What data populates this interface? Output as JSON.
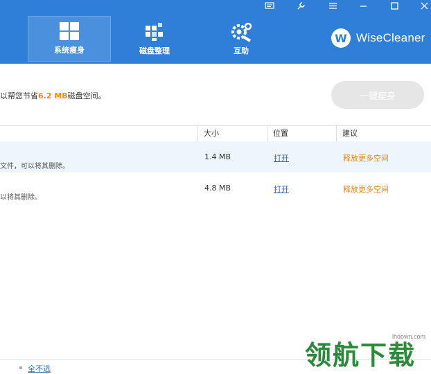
{
  "header": {
    "tabs": [
      {
        "label": "系统瘦身",
        "icon": "windows-icon"
      },
      {
        "label": "磁盘整理",
        "icon": "defrag-icon"
      },
      {
        "label": "互助",
        "icon": "gears-icon"
      }
    ],
    "brand": {
      "logo_letter": "W",
      "name": "WiseCleaner"
    },
    "window_controls": [
      "feedback-icon",
      "tools-icon",
      "menu-icon",
      "minimize-icon",
      "maximize-icon",
      "close-icon"
    ]
  },
  "info": {
    "prefix": "以帮您节省",
    "amount": "6.2 MB",
    "suffix": "磁盘空间。",
    "button_label": "一键瘦身"
  },
  "table": {
    "columns": [
      "大小",
      "位置",
      "建议"
    ],
    "rows": [
      {
        "desc": "文件，可以将其删除。",
        "size": "1.4 MB",
        "location": "打开",
        "advice": "释放更多空间"
      },
      {
        "desc": "以将其删除。",
        "size": "4.8 MB",
        "location": "打开",
        "advice": "释放更多空间"
      }
    ]
  },
  "footer": {
    "select_none": "全不选"
  },
  "watermark": {
    "site": "lhdown.com",
    "brand": "领航下载"
  },
  "colors": {
    "header": "#2f7ed8",
    "accent_orange": "#f08a00",
    "link_blue": "#2f6fb8"
  }
}
